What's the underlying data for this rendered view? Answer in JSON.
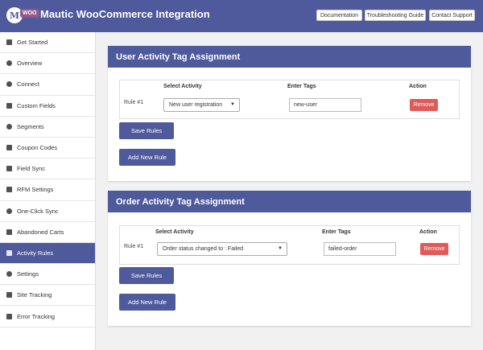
{
  "header": {
    "logo_letter": "M",
    "woo_badge": "WOO",
    "title": "Mautic WooCommerce Integration",
    "buttons": {
      "documentation": "Documentation",
      "troubleshooting": "Troubleshooting Guide",
      "support": "Contact Support"
    }
  },
  "sidebar": {
    "items": [
      {
        "label": "Get Started",
        "icon": "grid-icon"
      },
      {
        "label": "Overview",
        "icon": "settings-circle-icon"
      },
      {
        "label": "Connect",
        "icon": "link-icon"
      },
      {
        "label": "Custom Fields",
        "icon": "list-icon"
      },
      {
        "label": "Segments",
        "icon": "pie-chart-icon"
      },
      {
        "label": "Coupon Codes",
        "icon": "tag-icon"
      },
      {
        "label": "Field Sync",
        "icon": "exchange-icon"
      },
      {
        "label": "RFM Settings",
        "icon": "star-icon"
      },
      {
        "label": "One-Click Sync",
        "icon": "refresh-icon"
      },
      {
        "label": "Abandoned Carts",
        "icon": "cart-icon"
      },
      {
        "label": "Activity Rules",
        "icon": "list-icon"
      },
      {
        "label": "Settings",
        "icon": "gears-icon"
      },
      {
        "label": "Site Tracking",
        "icon": "chart-line-icon"
      },
      {
        "label": "Error Tracking",
        "icon": "warning-icon"
      }
    ],
    "active": "Activity Rules"
  },
  "user_panel": {
    "title": "User Activity Tag Assignment",
    "headers": {
      "activity": "Select Activity",
      "tags": "Enter Tags",
      "action": "Action"
    },
    "rule": {
      "label": "Rule #1",
      "activity": "New user registration",
      "tags": "new-user",
      "remove": "Remove"
    },
    "save_label": "Save Rules",
    "add_label": "Add New Rule"
  },
  "order_panel": {
    "title": "Order Activity Tag Assignment",
    "headers": {
      "activity": "Select Activity",
      "tags": "Enter Tags",
      "action": "Action"
    },
    "rule": {
      "label": "Rule #1",
      "activity": "Order status changed to : Failed",
      "tags": "failed-order",
      "remove": "Remove"
    },
    "save_label": "Save Rules",
    "add_label": "Add New Rule"
  },
  "colors": {
    "primary": "#4e5a9c",
    "danger": "#e05a5a",
    "woo": "#96588a"
  }
}
